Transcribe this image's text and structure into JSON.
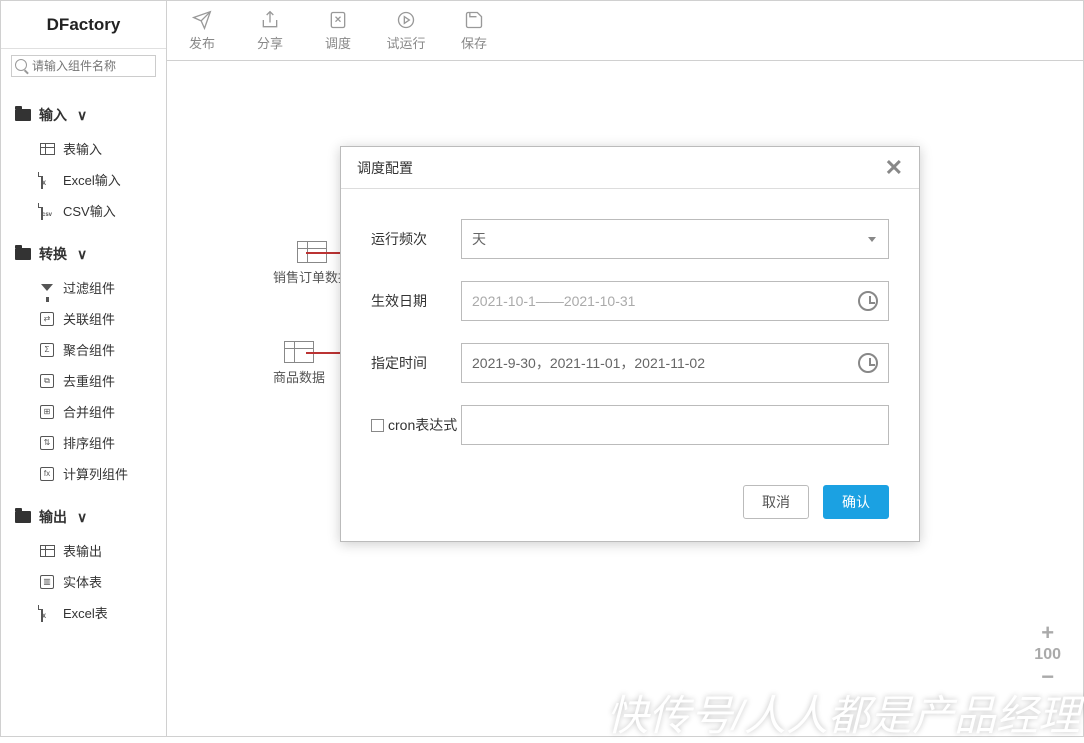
{
  "brand": "DFactory",
  "search": {
    "placeholder": "请输入组件名称"
  },
  "sidebar": {
    "groups": [
      {
        "label": "输入",
        "items": [
          {
            "label": "表输入",
            "icon": "table-icon"
          },
          {
            "label": "Excel输入",
            "icon": "file-excel-icon"
          },
          {
            "label": "CSV输入",
            "icon": "file-csv-icon"
          }
        ]
      },
      {
        "label": "转换",
        "items": [
          {
            "label": "过滤组件",
            "icon": "filter-icon"
          },
          {
            "label": "关联组件",
            "icon": "join-icon"
          },
          {
            "label": "聚合组件",
            "icon": "aggregate-icon"
          },
          {
            "label": "去重组件",
            "icon": "dedupe-icon"
          },
          {
            "label": "合并组件",
            "icon": "merge-icon"
          },
          {
            "label": "排序组件",
            "icon": "sort-icon"
          },
          {
            "label": "计算列组件",
            "icon": "calc-icon"
          }
        ]
      },
      {
        "label": "输出",
        "items": [
          {
            "label": "表输出",
            "icon": "table-icon"
          },
          {
            "label": "实体表",
            "icon": "entity-table-icon"
          },
          {
            "label": "Excel表",
            "icon": "file-excel-icon"
          }
        ]
      }
    ]
  },
  "toolbar": {
    "publish": "发布",
    "share": "分享",
    "schedule": "调度",
    "testrun": "试运行",
    "save": "保存"
  },
  "canvas": {
    "nodes": [
      {
        "label": "销售订单数据"
      },
      {
        "label": "商品数据"
      }
    ]
  },
  "modal": {
    "title": "调度配置",
    "fields": {
      "frequency_label": "运行频次",
      "frequency_value": "天",
      "effective_date_label": "生效日期",
      "effective_date_placeholder": "2021-10-1——2021-10-31",
      "specific_time_label": "指定时间",
      "specific_time_value": "2021-9-30，2021-11-01，2021-11-02",
      "cron_label": "cron表达式",
      "cron_value": ""
    },
    "buttons": {
      "cancel": "取消",
      "confirm": "确认"
    }
  },
  "zoom": {
    "value": "100"
  },
  "watermark": "快传号/人人都是产品经理"
}
